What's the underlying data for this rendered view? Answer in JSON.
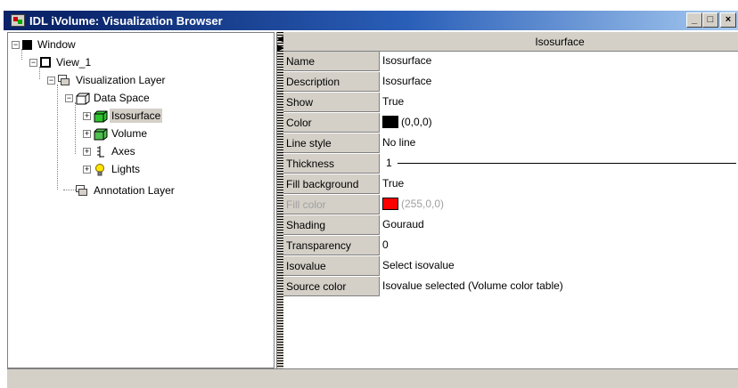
{
  "window": {
    "title": "IDL iVolume: Visualization Browser",
    "minimize_glyph": "_",
    "maximize_glyph": "□",
    "close_glyph": "×"
  },
  "tree": {
    "window_label": "Window",
    "view_label": "View_1",
    "vis_layer_label": "Visualization Layer",
    "data_space_label": "Data Space",
    "isosurface_label": "Isosurface",
    "volume_label": "Volume",
    "axes_label": "Axes",
    "lights_label": "Lights",
    "annotation_layer_label": "Annotation Layer",
    "expander_open": "−",
    "expander_closed": "+"
  },
  "grid": {
    "header": "Isosurface",
    "rows": [
      {
        "name": "Name",
        "value": "Isosurface"
      },
      {
        "name": "Description",
        "value": "Isosurface"
      },
      {
        "name": "Show",
        "value": "True"
      },
      {
        "name": "Color",
        "value": "(0,0,0)",
        "swatch": "#000000"
      },
      {
        "name": "Line style",
        "value": "No line"
      },
      {
        "name": "Thickness",
        "value": "1"
      },
      {
        "name": "Fill background",
        "value": "True"
      },
      {
        "name": "Fill color",
        "value": "(255,0,0)",
        "swatch": "#ff0000",
        "disabled": true
      },
      {
        "name": "Shading",
        "value": "Gouraud"
      },
      {
        "name": "Transparency",
        "value": "0"
      },
      {
        "name": "Isovalue",
        "value": "Select isovalue"
      },
      {
        "name": "Source color",
        "value": "Isovalue selected (Volume color table)"
      }
    ]
  },
  "colors": {
    "titlebar_start": "#0a246a",
    "titlebar_end": "#a6caf0",
    "panel_gray": "#d4d0c8"
  }
}
